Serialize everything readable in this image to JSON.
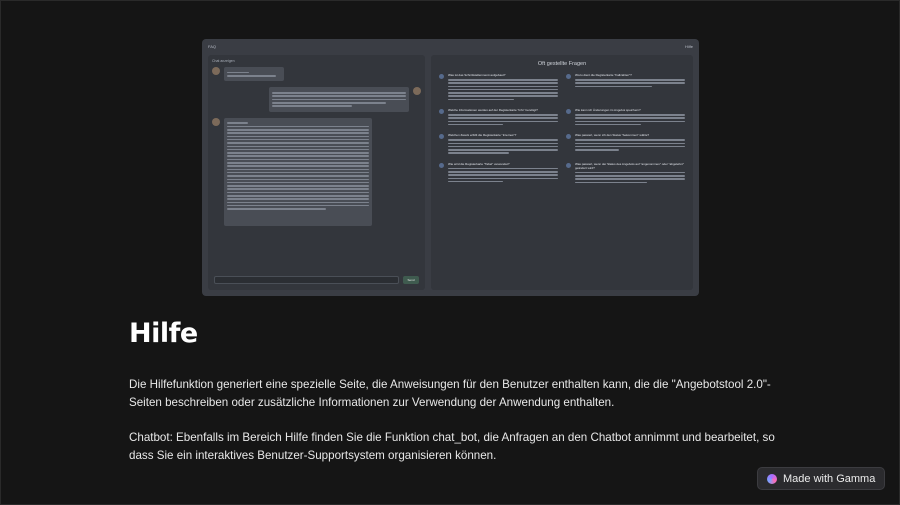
{
  "screenshot": {
    "window_title": "FAQ",
    "window_right_label": "Hilfe",
    "chat": {
      "header": "Chat anzeigen",
      "send_label": "Send"
    },
    "faq": {
      "title": "Oft gestellte Fragen",
      "questions": [
        "Was ist das Schnittstellenmenü aufgebaut?",
        "Wozu dient die Registerkarte \"Fallzahlen\"?",
        "Wie kann ich Änderungen im Angebot speichern?",
        "Welche Informationen werden auf der Registerkarte \"Info\" benötigt?",
        "Was passiert, wenn ich den Status \"bekommen\" wähle?",
        "Welchen Zweck erfüllt die Registerkarte \"Internes\"?",
        "Was passiert, wenn der Status des Angebots auf \"angenommen\" oder \"abgelehnt\" geändert wird?",
        "Wie wird die Registerkarte \"Tabel\" verwendet?"
      ]
    }
  },
  "page": {
    "title": "Hilfe",
    "paragraph1": "Die Hilfefunktion generiert eine spezielle Seite, die Anweisungen für den Benutzer enthalten kann, die die \"Angebotstool 2.0\"-Seiten beschreiben oder zusätzliche Informationen zur Verwendung der Anwendung enthalten.",
    "paragraph2": "Chatbot: Ebenfalls im Bereich Hilfe finden Sie die Funktion chat_bot, die Anfragen an den Chatbot annimmt und bearbeitet, so dass Sie ein interaktives Benutzer-Supportsystem organisieren können."
  },
  "badge": {
    "label": "Made with Gamma",
    "icon": "gamma-logo-icon"
  },
  "colors": {
    "background": "#151515",
    "screenshot_bg": "#3a3d44",
    "text": "#e8e8e8"
  }
}
